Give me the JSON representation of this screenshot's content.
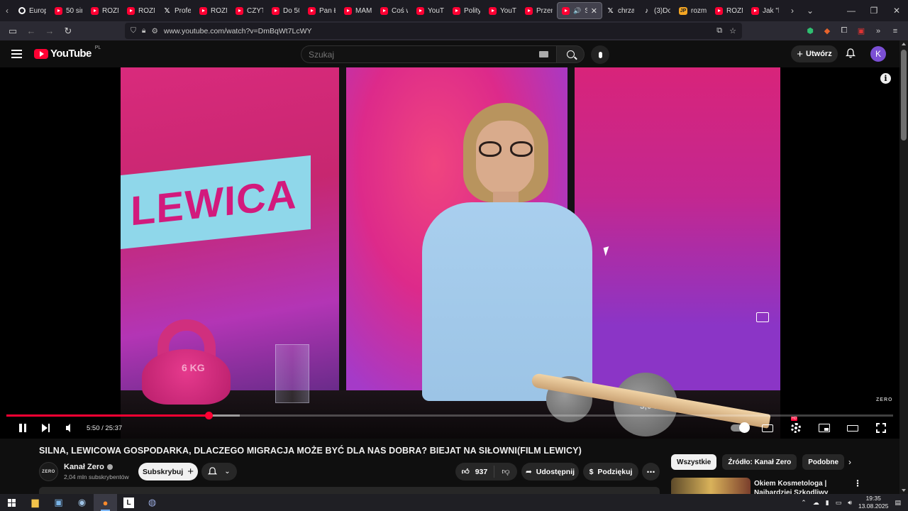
{
  "browser": {
    "tabs": [
      {
        "title": "Europ",
        "favicon": "circle-icon"
      },
      {
        "title": "50 sin",
        "favicon": "youtube-icon"
      },
      {
        "title": "ROZM",
        "favicon": "youtube-icon"
      },
      {
        "title": "ROZM",
        "favicon": "youtube-icon"
      },
      {
        "title": "Profes",
        "favicon": "x-icon"
      },
      {
        "title": "ROZM",
        "favicon": "youtube-icon"
      },
      {
        "title": "CZYTA",
        "favicon": "youtube-icon"
      },
      {
        "title": "Do 50",
        "favicon": "youtube-icon"
      },
      {
        "title": "Pan Ł",
        "favicon": "youtube-icon"
      },
      {
        "title": "MAMY",
        "favicon": "youtube-icon"
      },
      {
        "title": "Coś w",
        "favicon": "youtube-icon"
      },
      {
        "title": "YouTu",
        "favicon": "youtube-icon"
      },
      {
        "title": "Polity",
        "favicon": "youtube-icon"
      },
      {
        "title": "YouTu",
        "favicon": "youtube-icon"
      },
      {
        "title": "Przem",
        "favicon": "youtube-icon"
      }
    ],
    "active_tab": {
      "title": "SILN",
      "favicon": "youtube-icon"
    },
    "tabs_after": [
      {
        "title": "chrzan",
        "favicon": "x-icon"
      },
      {
        "title": "(3)Dor",
        "favicon": "tiktok-icon"
      },
      {
        "title": "rozmo",
        "favicon": "jp-icon",
        "favicon_text": "JP"
      },
      {
        "title": "ROZM",
        "favicon": "youtube-icon"
      },
      {
        "title": "Jak \"li",
        "favicon": "youtube-icon"
      }
    ],
    "url": "www.youtube.com/watch?v=DmBqWt7LcWY"
  },
  "youtube": {
    "logo_text": "YouTube",
    "region": "PL",
    "search_placeholder": "Szukaj",
    "create_label": "Utwórz",
    "avatar_letter": "K"
  },
  "player": {
    "time_current": "5:50",
    "time_total": "25:37",
    "time_display": "5:50 / 25:37",
    "progress_fraction": 0.228,
    "buffer_fraction": 0.263,
    "watermark": "ZERO",
    "scene": {
      "sign_text": "LEWICA",
      "kettlebell_label": "6 KG",
      "dumbbell_label": "3,0 KG"
    }
  },
  "video": {
    "title": "SILNA, LEWICOWA GOSPODARKA, DLACZEGO MIGRACJA MOŻE BYĆ DLA NAS DOBRA? BIEJAT NA SIŁOWNI(FILM LEWICY)",
    "channel_avatar_text": "ZERO",
    "channel_name": "Kanał Zero",
    "subscribers": "2,04 mln subskrybentów",
    "subscribe_label": "Subskrybuj",
    "likes": "937",
    "share_label": "Udostępnij",
    "thanks_label": "Podziękuj"
  },
  "sidebar": {
    "chips": [
      "Wszystkie",
      "Źródło: Kanał Zero",
      "Podobne"
    ],
    "recommendation_title": "Okiem Kosmetologa | Najbardziej Szkodliwy Twórca..."
  },
  "taskbar": {
    "time": "19:35",
    "date": "13.08.2025"
  },
  "colors": {
    "accent": "#ff0033",
    "background": "#0f0f0f",
    "chip_active": "#f1f1f1"
  }
}
